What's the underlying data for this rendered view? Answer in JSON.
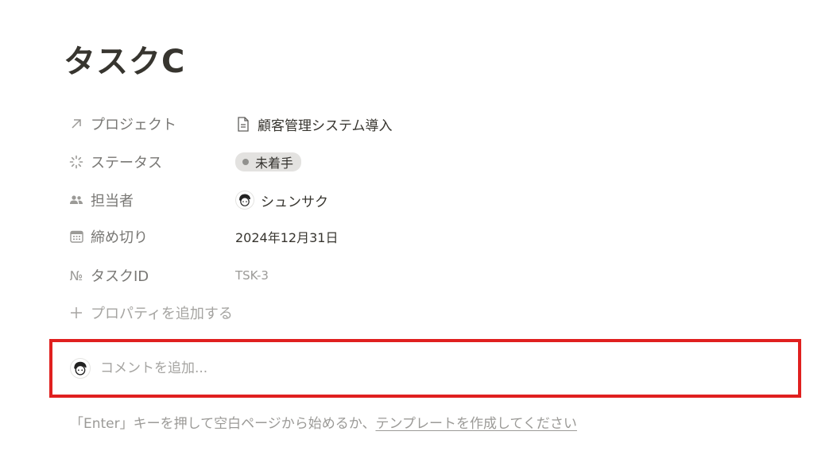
{
  "page": {
    "title": "タスクC"
  },
  "properties": [
    {
      "icon": "arrow-up-right-icon",
      "name": "プロジェクト",
      "value": "顧客管理システム導入",
      "value_icon": "document-icon"
    },
    {
      "icon": "status-spinner-icon",
      "name": "ステータス",
      "value": "未着手",
      "value_color": "#e3e2e0"
    },
    {
      "icon": "people-icon",
      "name": "担当者",
      "value": "シュンサク",
      "value_icon": "avatar"
    },
    {
      "icon": "calendar-icon",
      "name": "締め切り",
      "value": "2024年12月31日"
    },
    {
      "icon": "number-icon",
      "name": "タスクID",
      "value": "TSK-3",
      "icon_text": "№"
    }
  ],
  "add_property": {
    "icon": "plus-icon",
    "label": "プロパティを追加する"
  },
  "comment": {
    "placeholder": "コメントを追加...",
    "value": "",
    "highlight_color": "#e0201f"
  },
  "hint": {
    "prefix": "「Enter」キーを押して空白ページから始めるか、",
    "link": "テンプレートを作成してください"
  }
}
